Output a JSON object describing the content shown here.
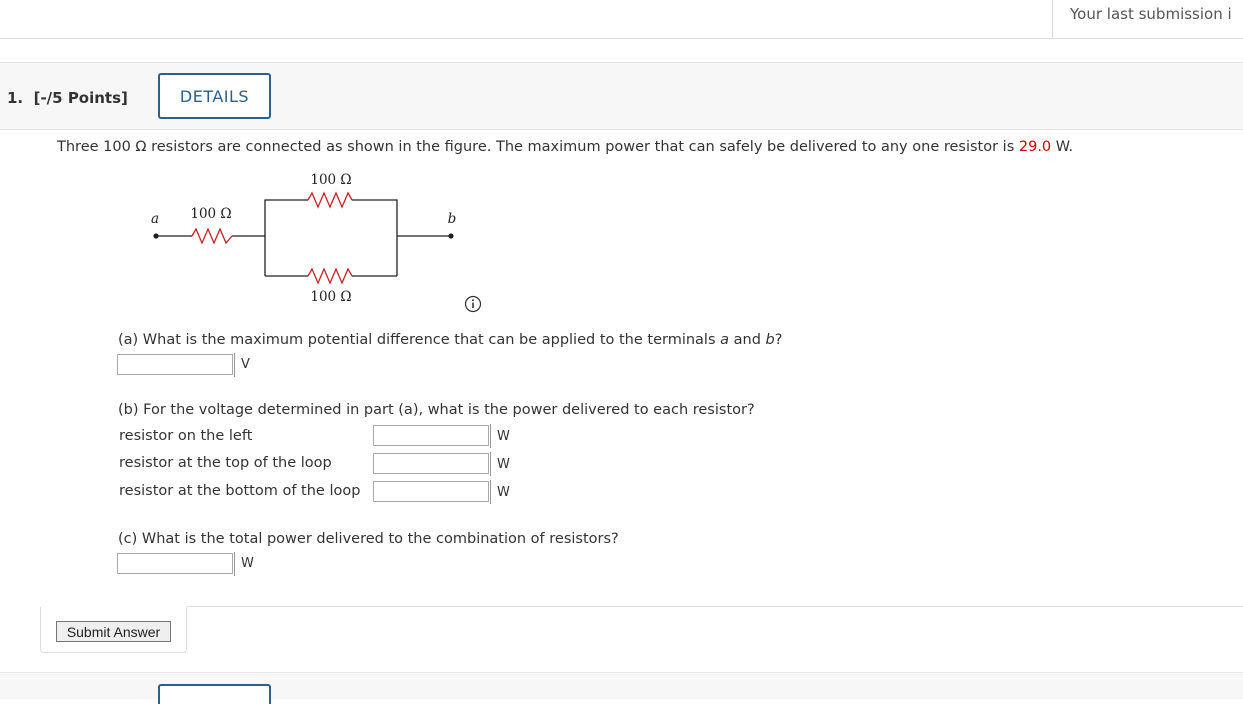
{
  "topbar": {
    "last_submission_text": "Your last submission i"
  },
  "question": {
    "number_label": "1.",
    "points_label": "[-/5 Points]",
    "details_label": "DETAILS",
    "intro_prefix": "Three 100 Ω resistors are connected as shown in the figure. The maximum power that can safely be delivered to any one resistor is ",
    "intro_value": "29.0",
    "intro_suffix": " W."
  },
  "circuit": {
    "top_resistor_label": "100 Ω",
    "left_resistor_label": "100 Ω",
    "bottom_resistor_label": "100 Ω",
    "terminal_a": "a",
    "terminal_b": "b",
    "wire_color": "#222222",
    "resistor_color": "#cc1f1f"
  },
  "parts": {
    "a": {
      "prompt_before": "(a) What is the maximum potential difference that can be applied to the terminals ",
      "var_a": "a",
      "and": " and ",
      "var_b": "b",
      "end": "?",
      "value": "",
      "unit": "V"
    },
    "b": {
      "prompt": "(b) For the voltage determined in part (a), what is the power delivered to each resistor?",
      "rows": [
        {
          "label": "resistor on the left",
          "value": "",
          "unit": "W"
        },
        {
          "label": "resistor at the top of the loop",
          "value": "",
          "unit": "W"
        },
        {
          "label": "resistor at the bottom of the loop",
          "value": "",
          "unit": "W"
        }
      ]
    },
    "c": {
      "prompt": "(c) What is the total power delivered to the combination of resistors?",
      "value": "",
      "unit": "W"
    }
  },
  "submit": {
    "label": "Submit Answer"
  },
  "colors": {
    "accent": "#2a5f8f",
    "highlight": "#cc0000"
  }
}
